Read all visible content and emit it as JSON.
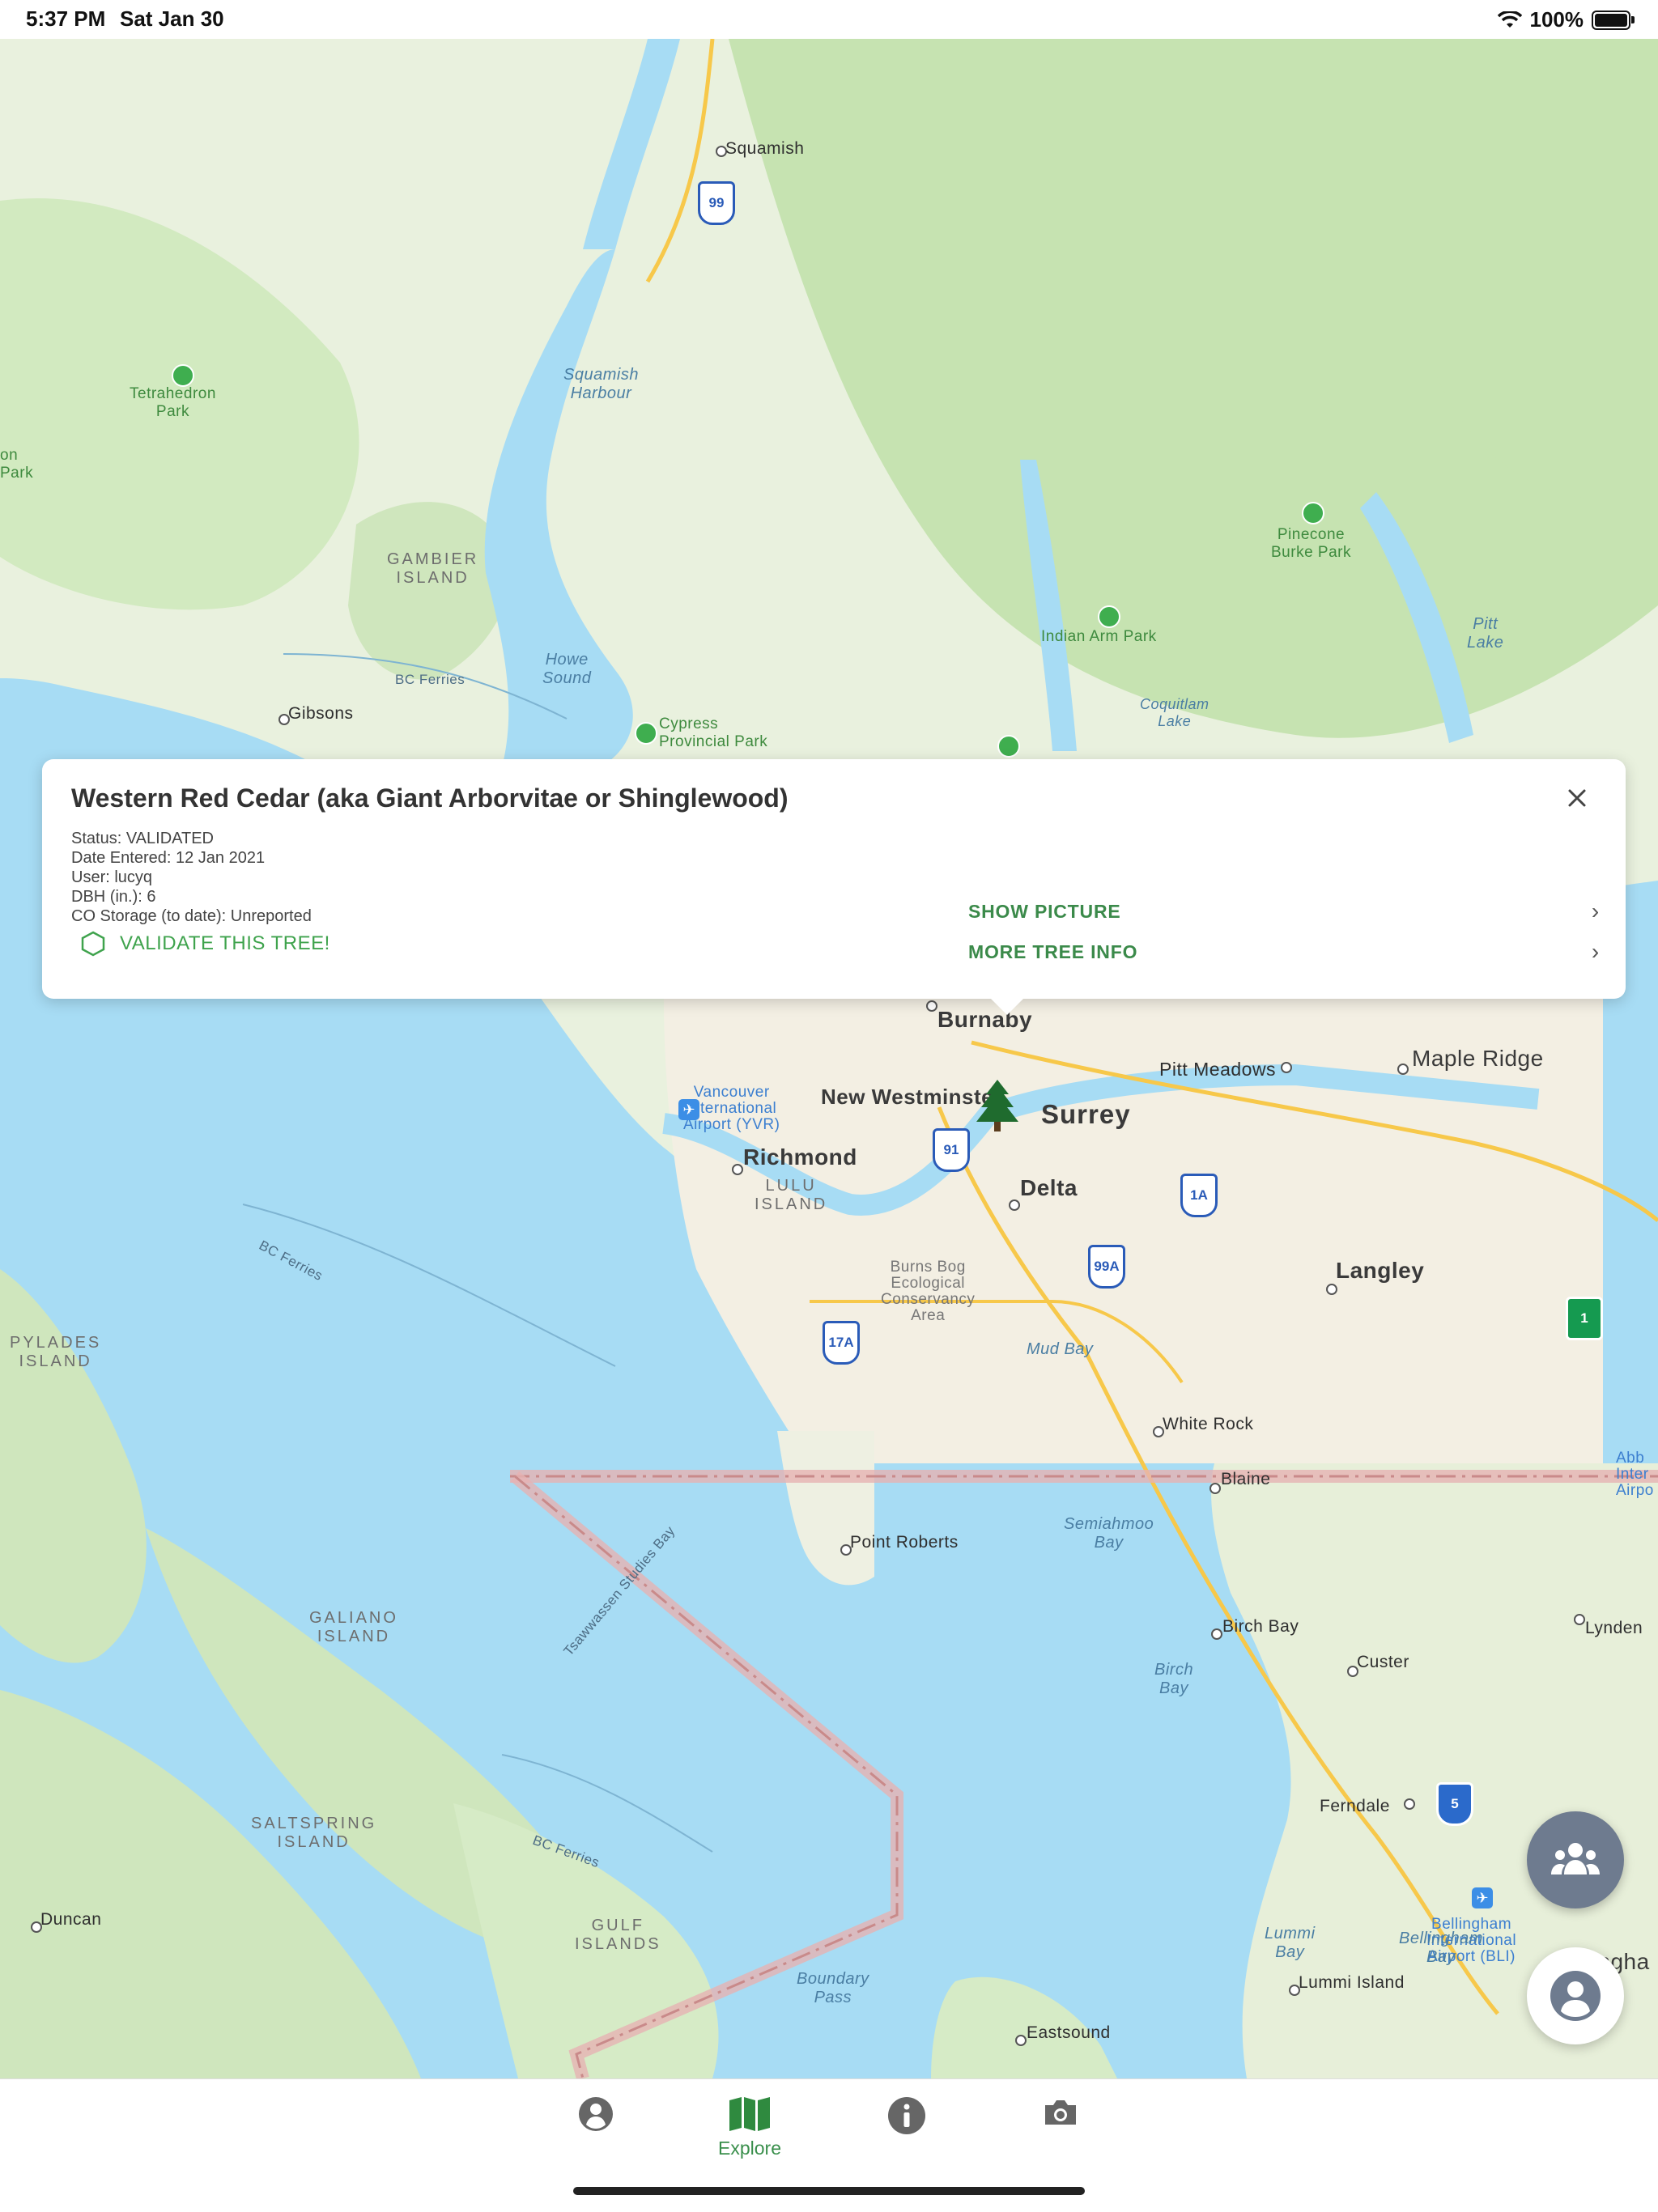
{
  "status_bar": {
    "time": "5:37 PM",
    "date": "Sat Jan 30",
    "battery": "100%"
  },
  "map": {
    "cities": [
      "Squamish",
      "Burnaby",
      "New Westminster",
      "Surrey",
      "Richmond",
      "Delta",
      "Langley",
      "Pitt Meadows",
      "Maple Ridge",
      "White Rock",
      "Blaine",
      "Point Roberts",
      "Birch Bay",
      "Custer",
      "Lynden",
      "Ferndale",
      "Bellingham",
      "Lummi Island",
      "Eastsound",
      "Gibsons",
      "Duncan"
    ],
    "labels": {
      "squamish": "Squamish",
      "tetrahedron": "Tetrahedron\nPark",
      "squamish_harbour": "Squamish\nHarbour",
      "gambier": "GAMBIER\nISLAND",
      "howe_sound": "Howe\nSound",
      "bc_ferries_1": "BC Ferries",
      "gibsons": "Gibsons",
      "cypress": "Cypress\nProvincial Park",
      "pinecone": "Pinecone\nBurke Park",
      "indian_arm": "Indian Arm Park",
      "coquitlam_lake": "Coquitlam\nLake",
      "pitt_lake": "Pitt\nLake",
      "left_park": "on\nPark",
      "burnaby": "Burnaby",
      "new_westminster": "New Westminster",
      "surrey": "Surrey",
      "pitt_meadows": "Pitt Meadows",
      "maple_ridge": "Maple Ridge",
      "yvr": "Vancouver\nInternational\nAirport (YVR)",
      "richmond": "Richmond",
      "lulu": "LULU\nISLAND",
      "delta": "Delta",
      "burns_bog": "Burns Bog\nEcological\nConservancy\nArea",
      "langley": "Langley",
      "bc_ferries_2": "BC Ferries",
      "pylades": "PYLADES\nISLAND",
      "mud_bay": "Mud Bay",
      "white_rock": "White Rock",
      "blaine": "Blaine",
      "abbotsford": "Abb\nInter\nAirpo",
      "point_roberts": "Point Roberts",
      "semiahmoo": "Semiahmoo\nBay",
      "tsawwassen": "Tsawwassen Studies Bay",
      "galiano": "GALIANO\nISLAND",
      "birch_bay": "Birch Bay",
      "birch_bay_water": "Birch\nBay",
      "custer": "Custer",
      "lynden": "Lynden",
      "saltspring": "SALTSPRING\nISLAND",
      "bc_ferries_3": "BC Ferries",
      "ferndale": "Ferndale",
      "gulf_islands": "GULF\nISLANDS",
      "duncan": "Duncan",
      "bli": "Bellingham\nInternational\nAirport (BLI)",
      "bellingham": "Bellingha",
      "lummi_bay": "Lummi\nBay",
      "bellingham_bay": "Bellingham\nBay",
      "lummi_island": "Lummi Island",
      "boundary_pass": "Boundary\nPass",
      "eastsound": "Eastsound"
    },
    "shields": {
      "s99": "99",
      "s91": "91",
      "s1a": "1A",
      "s99a": "99A",
      "s17a": "17A",
      "s5": "5",
      "s1": "1"
    }
  },
  "popup": {
    "title": "Western Red Cedar (aka Giant Arborvitae or Shinglewood)",
    "status": "Status: VALIDATED",
    "date_entered": "Date Entered: 12 Jan 2021",
    "user": "User: lucyq",
    "dbh": "DBH (in.): 6",
    "co_storage": "CO Storage (to date): Unreported",
    "validate_label": "VALIDATE THIS TREE!",
    "show_picture": "SHOW PICTURE",
    "more_info": "MORE TREE INFO",
    "chevron": "›"
  },
  "tabs": [
    {
      "label": "",
      "icon": "person-icon"
    },
    {
      "label": "Explore",
      "icon": "map-icon"
    },
    {
      "label": "",
      "icon": "info-icon"
    },
    {
      "label": "",
      "icon": "camera-icon"
    }
  ],
  "colors": {
    "accent_green": "#3b8a4a",
    "water": "#a7dcf4",
    "land": "#e8f0dc",
    "forest": "#c5e3b0"
  }
}
